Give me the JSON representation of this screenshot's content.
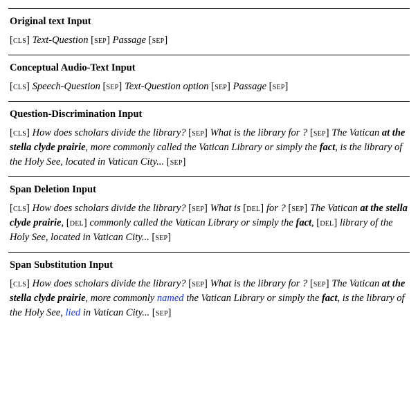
{
  "sections": {
    "orig": {
      "title": "Original text Input",
      "cls": "[cls]",
      "sep": "[sep]",
      "q": "Text-Question",
      "p": "Passage"
    },
    "conc": {
      "title": "Conceptual Audio-Text Input",
      "cls": "[cls]",
      "sep": "[sep]",
      "sq": "Speech-Question",
      "tq": "Text-Question option",
      "p": "Passage"
    },
    "qd": {
      "title": "Question-Discrimination Input",
      "cls": "[cls]",
      "sep": "[sep]",
      "q1": "How does scholars divide the library?",
      "q2": "What is the library for ?",
      "p1": "The Vatican",
      "b1": "at the stella clyde prairie",
      "p2": ", more commonly called the Vatican Library or simply the",
      "b2": "fact",
      "p3": ", is the library of the Holy See, located in Vatican City..."
    },
    "sd": {
      "title": "Span Deletion Input",
      "cls": "[cls]",
      "sep": "[sep]",
      "del": "[del]",
      "q1": "How does scholars divide the library?",
      "q2a": "What is",
      "q2b": "for ?",
      "p1": "The Vatican",
      "b1": "at the stella clyde prairie",
      "p2a": ",",
      "p2b": "commonly called the Vatican Library or simply the",
      "b2": "fact",
      "p3a": ",",
      "p3b": "library of the Holy See, located in Vatican City..."
    },
    "ss": {
      "title": "Span Substitution Input",
      "cls": "[cls]",
      "sep": "[sep]",
      "q1": "How does scholars divide the library?",
      "q2": "What is the library for ?",
      "p1": "The Vatican",
      "b1": "at the stella clyde prairie",
      "p2": ", more commonly",
      "sub1": "named",
      "p3": "the Vatican Library or simply the",
      "b2": "fact",
      "p4": ", is the library of the Holy See,",
      "sub2": "lied",
      "p5": "in Vatican City..."
    }
  }
}
